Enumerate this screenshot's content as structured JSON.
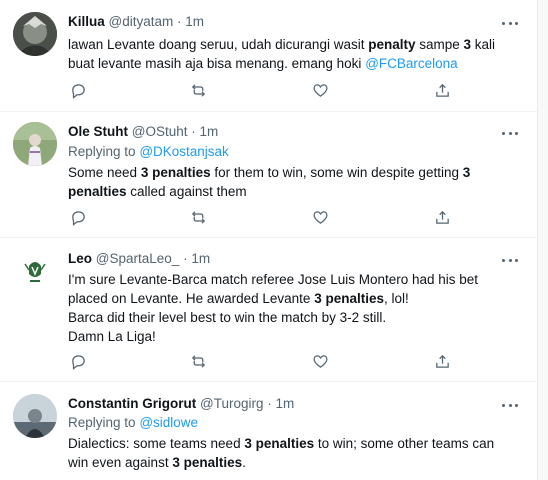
{
  "tweets": [
    {
      "name": "Killua",
      "handle": "@dityatam",
      "time": "1m",
      "dot": "·",
      "body": [
        {
          "t": "lawan Levante doang seruu, udah dicurangi wasit "
        },
        {
          "t": "penalty",
          "b": true
        },
        {
          "t": " sampe "
        },
        {
          "t": "3",
          "b": true
        },
        {
          "t": " kali buat levante masih aja bisa menang. emang hoki "
        },
        {
          "t": "@FCBarcelona",
          "m": true
        }
      ]
    },
    {
      "name": "Ole Stuht",
      "handle": "@OStuht",
      "time": "1m",
      "dot": "·",
      "replying_label": "Replying to",
      "replying_to": "@DKostanjsak",
      "body": [
        {
          "t": "Some need "
        },
        {
          "t": "3 penalties",
          "b": true
        },
        {
          "t": " for them to win, some win despite getting "
        },
        {
          "t": "3 penalties",
          "b": true
        },
        {
          "t": " called against them"
        }
      ]
    },
    {
      "name": "Leo",
      "handle": "@SpartaLeo_",
      "time": "1m",
      "dot": "·",
      "body": [
        {
          "t": "I'm sure Levante-Barca match referee Jose Luis Montero had his bet placed on Levante. He awarded Levante "
        },
        {
          "t": "3 penalties",
          "b": true
        },
        {
          "t": ", lol!\nBarca did their level best to win the match by 3-2 still.\nDamn La Liga!"
        }
      ]
    },
    {
      "name": "Constantin Grigorut",
      "handle": "@Turogirg",
      "time": "1m",
      "dot": "·",
      "replying_label": "Replying to",
      "replying_to": "@sidlowe",
      "body": [
        {
          "t": "Dialectics: some teams need "
        },
        {
          "t": "3 penalties",
          "b": true
        },
        {
          "t": " to win; some other teams can win even against "
        },
        {
          "t": "3 penalties",
          "b": true
        },
        {
          "t": "."
        }
      ]
    }
  ],
  "icons": {
    "reply": "reply-icon",
    "retweet": "retweet-icon",
    "like": "like-icon",
    "share": "share-icon",
    "more": "more-icon"
  },
  "colors": {
    "link": "#1d9bf0",
    "secondary": "#536471",
    "text": "#0f1419",
    "border": "#eff3f4"
  }
}
